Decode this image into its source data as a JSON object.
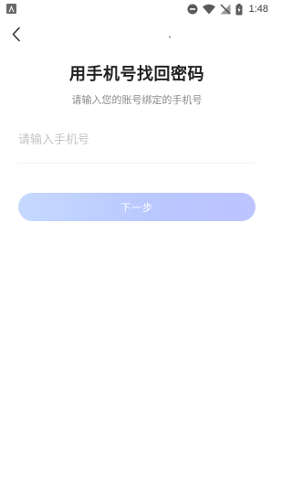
{
  "status_bar": {
    "time": "1:48",
    "left_icon": "android-notification-icon",
    "icons": [
      "do-not-disturb-icon",
      "wifi-icon",
      "no-signal-icon",
      "battery-charging-icon"
    ]
  },
  "nav": {
    "back_icon": "chevron-left-icon"
  },
  "header": {
    "title": "用手机号找回密码",
    "subtitle": "请输入您的账号绑定的手机号"
  },
  "form": {
    "phone_placeholder": "请输入手机号",
    "phone_value": "",
    "next_label": "下一步"
  },
  "colors": {
    "button_gradient_start": "#c6d9ff",
    "button_gradient_end": "#bdc3ff",
    "title": "#222222",
    "subtitle": "#8a8a8a",
    "placeholder": "#c4c4c4"
  }
}
